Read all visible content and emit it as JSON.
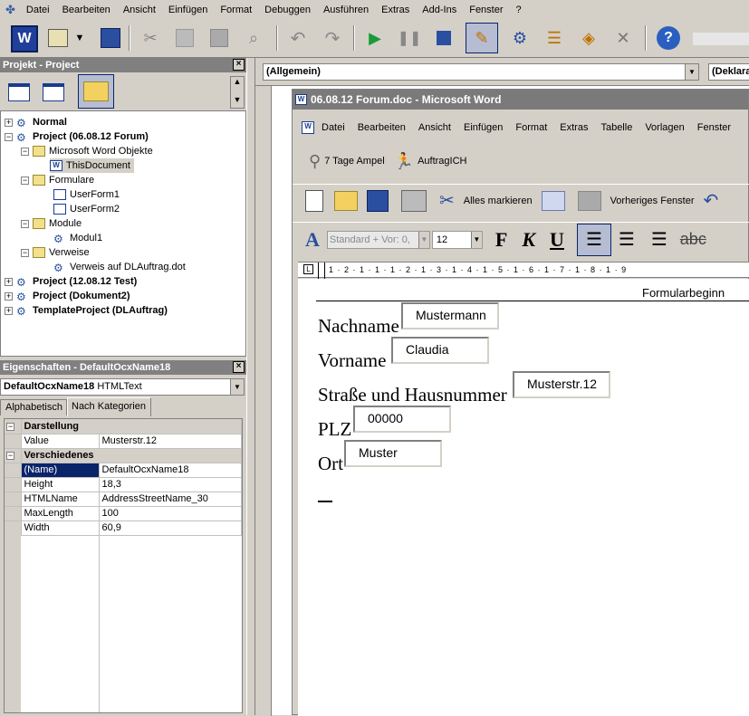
{
  "menu": {
    "items": [
      "Datei",
      "Bearbeiten",
      "Ansicht",
      "Einfügen",
      "Format",
      "Debuggen",
      "Ausführen",
      "Extras",
      "Add-Ins",
      "Fenster",
      "?"
    ]
  },
  "project_panel": {
    "title": "Projekt - Project",
    "tree": [
      {
        "label": "Normal",
        "bold": true
      },
      {
        "label": "Project (06.08.12 Forum)",
        "bold": true
      },
      {
        "label": "Microsoft Word Objekte"
      },
      {
        "label": "ThisDocument"
      },
      {
        "label": "Formulare"
      },
      {
        "label": "UserForm1"
      },
      {
        "label": "UserForm2"
      },
      {
        "label": "Module"
      },
      {
        "label": "Modul1"
      },
      {
        "label": "Verweise"
      },
      {
        "label": "Verweis auf DLAuftrag.dot"
      },
      {
        "label": "Project (12.08.12 Test)",
        "bold": true
      },
      {
        "label": "Project (Dokument2)",
        "bold": true
      },
      {
        "label": "TemplateProject (DLAuftrag)",
        "bold": true
      }
    ]
  },
  "properties_panel": {
    "title": "Eigenschaften - DefaultOcxName18",
    "object_name": "DefaultOcxName18",
    "object_type": "HTMLText",
    "tabs": [
      "Alphabetisch",
      "Nach Kategorien"
    ],
    "cat1": "Darstellung",
    "cat2": "Verschiedenes",
    "rows": [
      {
        "name": "Value",
        "value": "Musterstr.12"
      },
      {
        "name": "(Name)",
        "value": "DefaultOcxName18"
      },
      {
        "name": "Height",
        "value": "18,3"
      },
      {
        "name": "HTMLName",
        "value": "AddressStreetName_30"
      },
      {
        "name": "MaxLength",
        "value": "100"
      },
      {
        "name": "Width",
        "value": "60,9"
      }
    ]
  },
  "code_window": {
    "combo_left": "(Allgemein)",
    "combo_right": "(Deklara"
  },
  "word": {
    "title": "06.08.12 Forum.doc - Microsoft Word",
    "menu": [
      "Datei",
      "Bearbeiten",
      "Ansicht",
      "Einfügen",
      "Format",
      "Extras",
      "Tabelle",
      "Vorlagen",
      "Fenster"
    ],
    "custom_buttons": [
      "7 Tage Ampel",
      "AuftragICH"
    ],
    "toolbar_labels": [
      "Alles markieren",
      "Vorheriges Fenster"
    ],
    "style": "Standard + Vor: 0,",
    "size": "12",
    "ruler": "1 · 2 · 1 · 1 · 1 · 2 · 1 · 3 · 1 · 4 · 1 · 5 · 1 · 6 · 1 · 7 · 1 · 8 · 1 · 9",
    "form_start": "Formularbeginn",
    "fields": [
      {
        "label": "Nachname",
        "value": "Mustermann"
      },
      {
        "label": "Vorname",
        "value": "Claudia"
      },
      {
        "label": "Straße und Hausnummer",
        "value": "Musterstr.12"
      },
      {
        "label": "PLZ",
        "value": "00000"
      },
      {
        "label": "Ort",
        "value": "Muster"
      }
    ]
  }
}
